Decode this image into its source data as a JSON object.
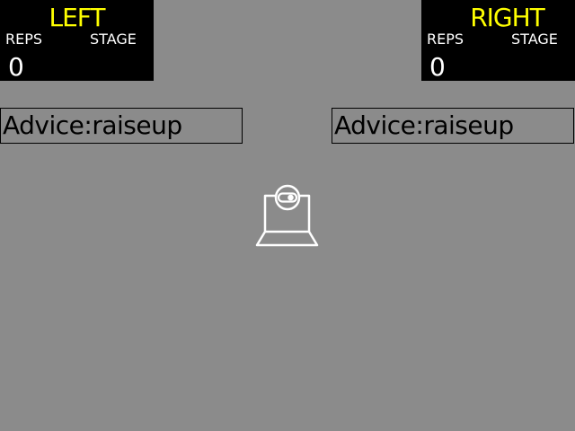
{
  "colors": {
    "background": "#8b8b8b",
    "panel": "#000000",
    "title_accent": "#ffff00",
    "text_light": "#ffffff",
    "advice_text": "#000000"
  },
  "left_panel": {
    "title": "LEFT",
    "reps_label": "REPS",
    "stage_label": "STAGE",
    "reps_value": "0",
    "stage_value": ""
  },
  "right_panel": {
    "title": "RIGHT",
    "reps_label": "REPS",
    "stage_label": "STAGE",
    "reps_value": "0",
    "stage_value": ""
  },
  "advice": {
    "left": "Advice:raiseup",
    "right": "Advice:raiseup"
  },
  "center_icon": "webcam-icon"
}
